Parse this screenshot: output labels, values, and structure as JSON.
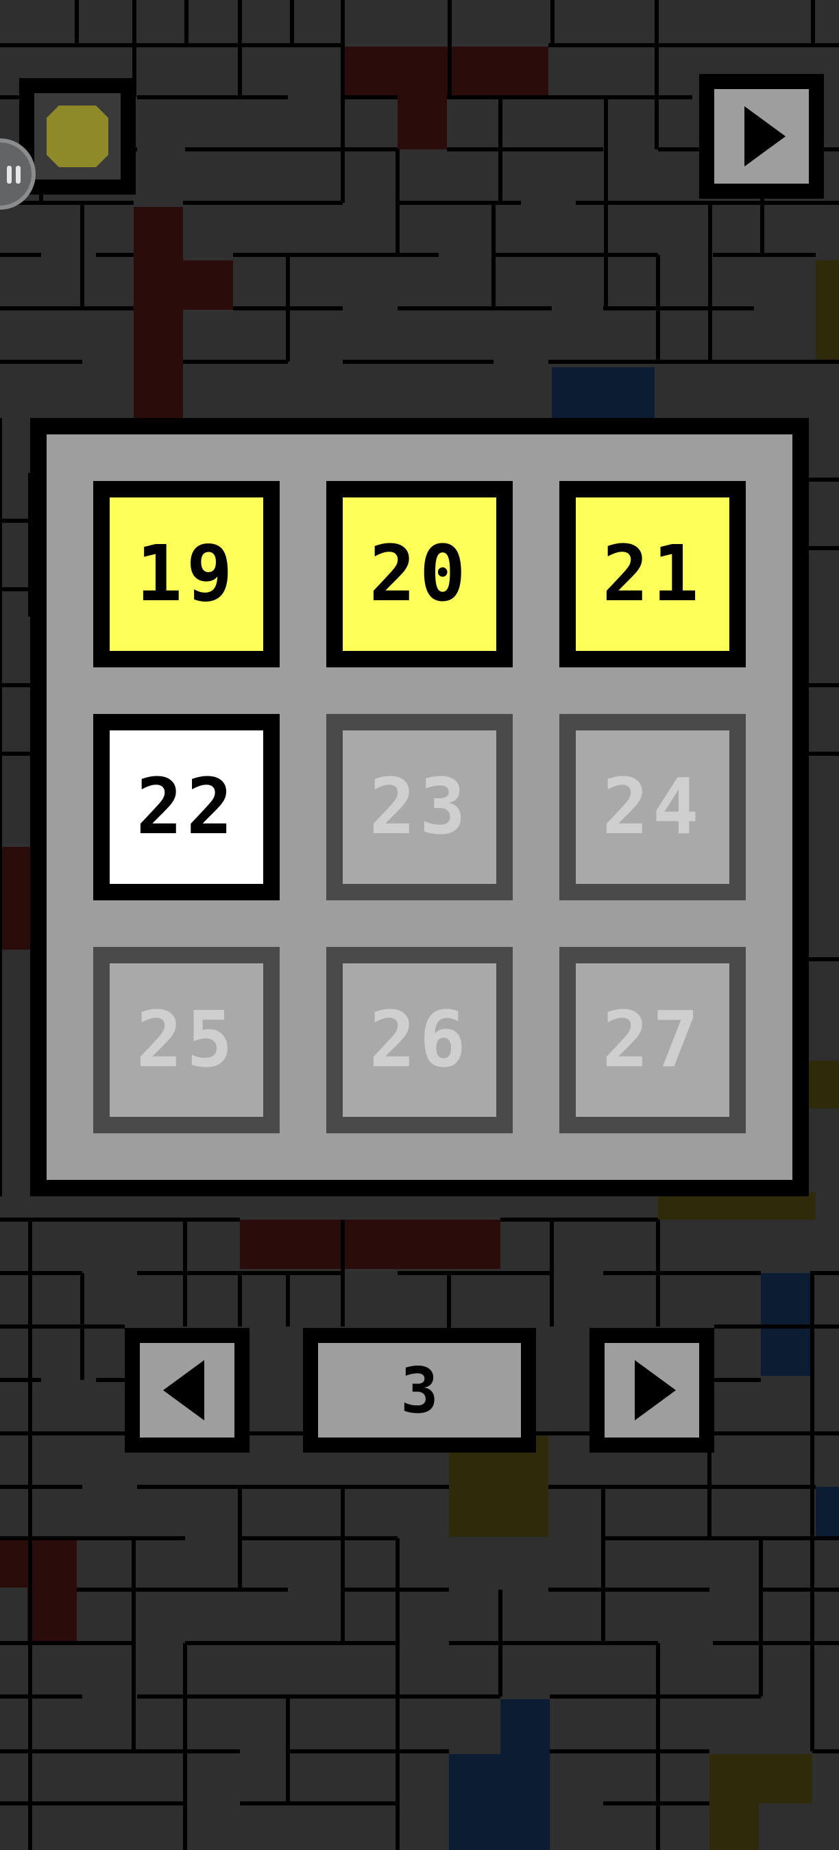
{
  "background": {
    "base_color": "#2f2f2f",
    "line_color": "#000000",
    "accent_colors": [
      "#2a0d0b",
      "#2e2a0a",
      "#0c1d33"
    ]
  },
  "top_bar": {
    "token_icon": "yellow-coin-icon",
    "token_color": "#8e8a2a",
    "side_badge_icon": "pause-icon",
    "play_icon": "play-icon"
  },
  "levels": {
    "colors": {
      "done": "#ffff5a",
      "current": "#ffffff",
      "locked": "#a9a9a9"
    },
    "tiles": [
      {
        "number": "19",
        "state": "done"
      },
      {
        "number": "20",
        "state": "done"
      },
      {
        "number": "21",
        "state": "done"
      },
      {
        "number": "22",
        "state": "current"
      },
      {
        "number": "23",
        "state": "locked"
      },
      {
        "number": "24",
        "state": "locked"
      },
      {
        "number": "25",
        "state": "locked"
      },
      {
        "number": "26",
        "state": "locked"
      },
      {
        "number": "27",
        "state": "locked"
      }
    ]
  },
  "pager": {
    "prev_icon": "arrow-left-icon",
    "next_icon": "arrow-right-icon",
    "page": "3"
  }
}
